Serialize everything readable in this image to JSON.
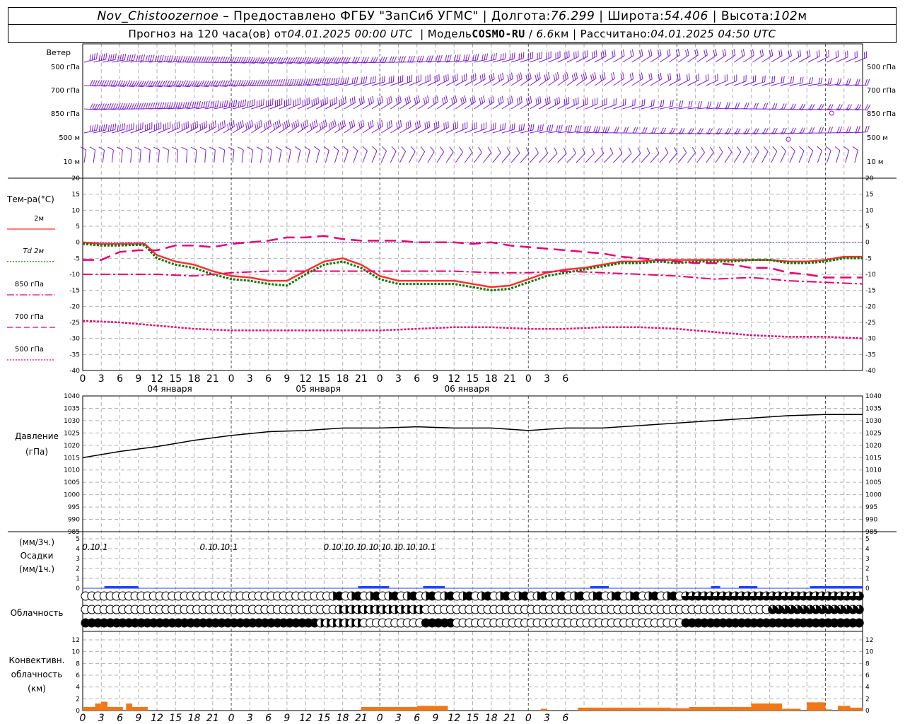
{
  "header": {
    "station": "Nov_Chistoozernoe",
    "sep1": " – ",
    "provider": "Предоставлено ФГБУ \"ЗапСиб УГМС\"",
    "lon_label": "Долгота:",
    "lon": "76.299",
    "lat_label": "Широта:",
    "lat": "54.406",
    "alt_label": "Высота:",
    "alt": "102",
    "alt_unit": "м",
    "forecast_label": "Прогноз на 120 часа(ов) от",
    "forecast_from": "04.01.2025 00:00 UTC",
    "model_label": "Модель",
    "model": "COSMO-RU",
    "resolution": "6.6",
    "resolution_unit": "км",
    "computed_label": "Рассчитано:",
    "computed": "04.01.2025 04:50 UTC"
  },
  "panels": {
    "wind": {
      "title": "Ветер",
      "levels": [
        "500 гПа",
        "700 гПа",
        "850 гПа",
        "500 м",
        "10 м"
      ]
    },
    "temperature": {
      "title": "Тем-ра(°C)",
      "legend": [
        {
          "label": "2м",
          "color": "#ff3030",
          "dash": "solid"
        },
        {
          "label": "Td  2м",
          "color": "#007a00",
          "dash": "dotted"
        },
        {
          "label": "850 гПа",
          "color": "#e8006e",
          "dash": "dashdot"
        },
        {
          "label": "700 гПа",
          "color": "#e8006e",
          "dash": "dashed"
        },
        {
          "label": "500 гПа",
          "color": "#e8006e",
          "dash": "dotted"
        }
      ],
      "yticks": [
        "20",
        "15",
        "10",
        "5",
        "0",
        "-5",
        "-10",
        "-15",
        "-20",
        "-25",
        "-30",
        "-35",
        "-40"
      ],
      "ylim": [
        -40,
        20
      ]
    },
    "time_axis": {
      "hour_ticks": [
        "0",
        "3",
        "6",
        "9",
        "12",
        "15",
        "18",
        "21",
        "0",
        "3",
        "6",
        "9",
        "12",
        "15",
        "18",
        "21",
        "0",
        "3",
        "6",
        "9",
        "12",
        "15",
        "18",
        "21",
        "0",
        "3",
        "6"
      ],
      "day_labels": [
        "04 января",
        "05 января",
        "06 января"
      ]
    },
    "pressure": {
      "title_line1": "Давление",
      "title_line2": "(гПа)",
      "yticks": [
        "1040",
        "1035",
        "1030",
        "1025",
        "1020",
        "1015",
        "1010",
        "1005",
        "1000",
        "995",
        "990",
        "985"
      ],
      "ylim": [
        985,
        1040
      ]
    },
    "precip": {
      "title_line1": "(мм/3ч.)",
      "title_line2": "Осадки",
      "title_line3": "(мм/1ч.)",
      "yticks": [
        "5",
        "4",
        "3",
        "2",
        "1",
        "0"
      ],
      "labels": [
        {
          "hour": 6,
          "text": "0.1"
        },
        {
          "hour": 18,
          "text": "0.1"
        },
        {
          "hour": 120,
          "text": "0.1"
        },
        {
          "hour": 132,
          "text": "0.1"
        },
        {
          "hour": 144,
          "text": "0.1"
        },
        {
          "hour": 240,
          "text": "0.1"
        },
        {
          "hour": 252,
          "text": "0.1"
        },
        {
          "hour": 264,
          "text": "0.1"
        },
        {
          "hour": 276,
          "text": "0.1"
        },
        {
          "hour": 288,
          "text": "0.1"
        },
        {
          "hour": 300,
          "text": "0.1"
        },
        {
          "hour": 312,
          "text": "0.1"
        },
        {
          "hour": 324,
          "text": "0.1"
        },
        {
          "hour": 336,
          "text": "0.1"
        }
      ]
    },
    "clouds": {
      "title": "Облачность"
    },
    "convective": {
      "title_line1": "Конвективн.",
      "title_line2": "облачность",
      "title_line3": "(км)",
      "yticks": [
        "12",
        "10",
        "8",
        "6",
        "4",
        "2",
        "0"
      ]
    }
  },
  "chart_data": {
    "type": "line",
    "x_unit": "hours from 04.01.2025 00:00 UTC",
    "x_range": [
      0,
      126
    ],
    "temperature": {
      "series": [
        {
          "name": "2м",
          "x": [
            0,
            3,
            6,
            9,
            10,
            12,
            15,
            18,
            21,
            24,
            27,
            30,
            33,
            36,
            39,
            42,
            45,
            48,
            51,
            54,
            57,
            60,
            63,
            66,
            69,
            72,
            75,
            78,
            81,
            84,
            87,
            90,
            93,
            96,
            99,
            102,
            105,
            108,
            111,
            114,
            117,
            120,
            123,
            126
          ],
          "values": [
            0,
            -0.5,
            -0.5,
            -0.4,
            -0.5,
            -4,
            -6,
            -7,
            -9,
            -10.5,
            -11,
            -12,
            -12,
            -9,
            -6,
            -5,
            -7,
            -10.5,
            -12,
            -12,
            -12,
            -12,
            -13,
            -14,
            -13.5,
            -11.5,
            -9.5,
            -8.5,
            -8,
            -7,
            -6,
            -6,
            -5.5,
            -5.5,
            -5.5,
            -5.5,
            -5.5,
            -5.5,
            -5.5,
            -6,
            -6,
            -5.5,
            -4.5,
            -4.5
          ]
        },
        {
          "name": "Td  2м",
          "x": [
            0,
            3,
            6,
            9,
            10,
            12,
            15,
            18,
            21,
            24,
            27,
            30,
            33,
            36,
            39,
            42,
            45,
            48,
            51,
            54,
            57,
            60,
            63,
            66,
            69,
            72,
            75,
            78,
            81,
            84,
            87,
            90,
            93,
            96,
            99,
            102,
            105,
            108,
            111,
            114,
            117,
            120,
            123,
            126
          ],
          "values": [
            -0.5,
            -1,
            -1,
            -0.8,
            -1,
            -5,
            -7,
            -8,
            -10,
            -11.5,
            -12,
            -13,
            -13.5,
            -10,
            -7,
            -6,
            -8,
            -11.5,
            -13,
            -13,
            -13,
            -13,
            -14,
            -15,
            -14.5,
            -12.5,
            -10.5,
            -9.5,
            -8.5,
            -7.5,
            -6.5,
            -6.5,
            -6,
            -6.5,
            -6,
            -6,
            -6,
            -5.5,
            -5.5,
            -6.5,
            -6.5,
            -6,
            -5,
            -5
          ]
        },
        {
          "name": "850 гПа",
          "x": [
            0,
            6,
            12,
            18,
            24,
            30,
            36,
            42,
            48,
            54,
            60,
            66,
            72,
            78,
            84,
            90,
            96,
            102,
            108,
            114,
            120,
            126
          ],
          "values": [
            -10,
            -10,
            -10,
            -10.5,
            -9.5,
            -9,
            -9,
            -9,
            -9,
            -9,
            -9,
            -9.5,
            -9.5,
            -9,
            -9.5,
            -10,
            -10.5,
            -11.5,
            -11,
            -12,
            -12.5,
            -13
          ]
        },
        {
          "name": "700 гПа",
          "x": [
            0,
            3,
            6,
            9,
            12,
            15,
            18,
            21,
            24,
            27,
            30,
            33,
            36,
            39,
            42,
            45,
            48,
            51,
            54,
            57,
            60,
            63,
            66,
            69,
            72,
            75,
            78,
            81,
            84,
            87,
            90,
            93,
            96,
            99,
            102,
            105,
            108,
            111,
            114,
            117,
            120,
            123,
            126
          ],
          "values": [
            -5.5,
            -5.5,
            -3,
            -2.5,
            -2.5,
            -1,
            -1,
            -1.5,
            -0.5,
            0,
            0.5,
            1.5,
            1.5,
            2,
            1,
            0.5,
            0.5,
            0.5,
            0,
            0,
            0,
            -0.5,
            0,
            -1,
            -1.5,
            -2,
            -2.5,
            -3,
            -3.5,
            -4.5,
            -5,
            -5.5,
            -6,
            -6.5,
            -6.5,
            -7,
            -8,
            -8,
            -9.5,
            -10,
            -11,
            -11,
            -11
          ]
        },
        {
          "name": "500 гПа",
          "x": [
            0,
            6,
            12,
            18,
            24,
            30,
            36,
            42,
            48,
            54,
            60,
            66,
            72,
            78,
            84,
            90,
            96,
            102,
            108,
            114,
            120,
            126
          ],
          "values": [
            -24.5,
            -25,
            -26,
            -27,
            -27.5,
            -27.5,
            -27.5,
            -27.5,
            -27.5,
            -27,
            -26.5,
            -26.5,
            -27,
            -27,
            -26.5,
            -26.5,
            -27,
            -28,
            -29,
            -29.5,
            -29.5,
            -30
          ]
        }
      ],
      "ylim": [
        -40,
        20
      ]
    },
    "pressure": {
      "x": [
        0,
        6,
        12,
        18,
        24,
        30,
        36,
        42,
        48,
        54,
        60,
        66,
        72,
        78,
        84,
        90,
        96,
        102,
        108,
        114,
        120,
        126
      ],
      "values": [
        1015,
        1017.5,
        1019.5,
        1022,
        1024,
        1025.5,
        1026,
        1027,
        1027,
        1027.5,
        1027,
        1027,
        1026,
        1027,
        1027,
        1028,
        1029,
        1030,
        1031,
        1032,
        1032.5,
        1032.5
      ],
      "ylim": [
        985,
        1040
      ]
    },
    "precipitation_3h_mm": {
      "x": [
        0,
        3,
        6,
        9,
        12,
        15,
        18,
        21,
        24,
        27,
        30,
        33,
        36,
        39,
        42,
        45,
        48,
        51,
        54,
        57,
        60,
        63,
        66,
        69,
        72,
        75,
        78,
        81,
        84,
        87,
        90,
        93,
        96,
        99,
        102,
        105,
        108,
        111,
        114,
        117,
        120,
        123
      ],
      "values": [
        0,
        0.1,
        0.2,
        0.1,
        0,
        0,
        0,
        0,
        0,
        0,
        0,
        0,
        0,
        0,
        0,
        0,
        0,
        0,
        0,
        0,
        0,
        0,
        0,
        0,
        0,
        0,
        0,
        0,
        0,
        0,
        0,
        0,
        0,
        0,
        0,
        0,
        0,
        0,
        0,
        0,
        0,
        0
      ]
    },
    "convective_cloud_km": {
      "x": [
        0,
        3,
        6,
        9,
        12,
        15,
        18,
        21,
        24,
        27,
        30,
        33,
        36,
        39,
        42,
        45,
        48,
        51,
        54,
        57,
        60,
        63,
        66,
        69,
        72,
        75,
        78,
        81,
        84,
        87,
        90,
        93,
        96,
        99,
        102,
        105,
        108,
        111,
        114,
        117,
        120,
        123
      ],
      "values": [
        0.5,
        1,
        0.5,
        0.5,
        0,
        0,
        0,
        0,
        0,
        0,
        0,
        0,
        0,
        0,
        0,
        0,
        0,
        0,
        0,
        0,
        0,
        0,
        0,
        0,
        0,
        0,
        0,
        0,
        0,
        0,
        0,
        0,
        0,
        0,
        0,
        0,
        0,
        0,
        0,
        0,
        0,
        0
      ]
    }
  }
}
